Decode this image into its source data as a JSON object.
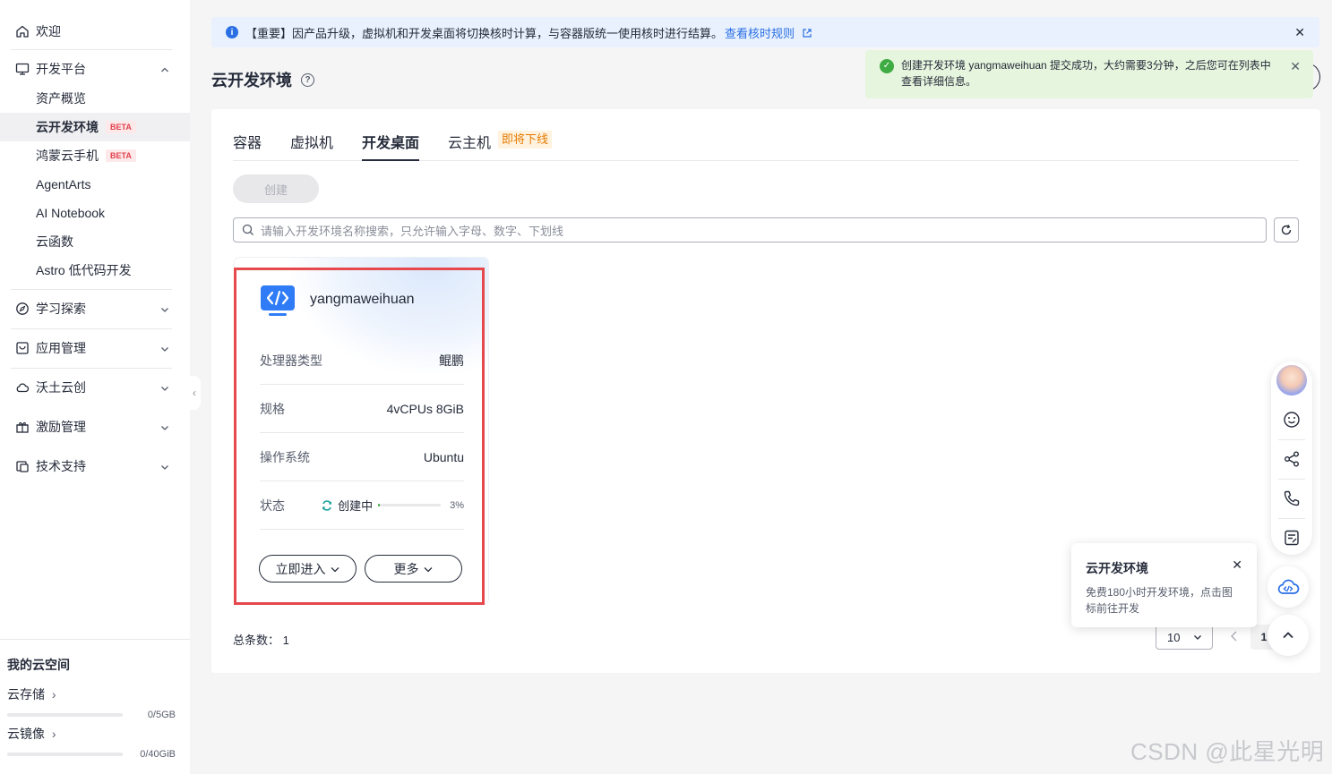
{
  "sidebar": {
    "welcome": "欢迎",
    "dev_platform": "开发平台",
    "dev_items": [
      {
        "label": "资产概览",
        "badge": ""
      },
      {
        "label": "云开发环境",
        "badge": "BETA"
      },
      {
        "label": "鸿蒙云手机",
        "badge": "BETA"
      },
      {
        "label": "AgentArts",
        "badge": ""
      },
      {
        "label": "AI Notebook",
        "badge": ""
      },
      {
        "label": "云函数",
        "badge": ""
      },
      {
        "label": "Astro 低代码开发",
        "badge": ""
      }
    ],
    "groups": [
      "学习探索",
      "应用管理",
      "沃土云创",
      "激励管理",
      "技术支持"
    ],
    "my_space_title": "我的云空间",
    "storage_label": "云存储",
    "storage_value": "0/5GB",
    "storage_used": 0,
    "image_label": "云镜像",
    "image_value": "0/40GiB",
    "image_used": 0
  },
  "banner": {
    "text": "【重要】因产品升级，虚拟机和开发桌面将切换核时计算，与容器版统一使用核时进行结算。",
    "link": "查看核时规则"
  },
  "page": {
    "title": "云开发环境"
  },
  "toast": {
    "message": "创建开发环境 yangmaweihuan 提交成功，大约需要3分钟，之后您可在列表中查看详细信息。"
  },
  "tabs": [
    {
      "label": "容器",
      "badge": ""
    },
    {
      "label": "虚拟机",
      "badge": ""
    },
    {
      "label": "开发桌面",
      "badge": ""
    },
    {
      "label": "云主机",
      "badge": "即将下线"
    }
  ],
  "active_tab": "开发桌面",
  "create_button": "创建",
  "search": {
    "placeholder": "请输入开发环境名称搜索，只允许输入字母、数字、下划线"
  },
  "card": {
    "name": "yangmaweihuan",
    "rows": [
      {
        "key": "处理器类型",
        "value": "鲲鹏"
      },
      {
        "key": "规格",
        "value": "4vCPUs 8GiB"
      },
      {
        "key": "操作系统",
        "value": "Ubuntu"
      }
    ],
    "status_key": "状态",
    "status_value": "创建中",
    "progress_label": "3%",
    "progress_percent": 3,
    "enter_button": "立即进入",
    "more_button": "更多"
  },
  "pagination": {
    "total_label": "总条数：",
    "total": "1",
    "page_size": "10",
    "current_page": "1"
  },
  "popup": {
    "title": "云开发环境",
    "desc": "免费180小时开发环境，点击图标前往开发"
  },
  "watermark": "CSDN @此星光明",
  "colors": {
    "accent_blue": "#2b6fe5",
    "success_green": "#3fac43",
    "highlight_red": "#e5484d",
    "beta_red": "#e0414c",
    "soon_orange": "#e57a00"
  }
}
